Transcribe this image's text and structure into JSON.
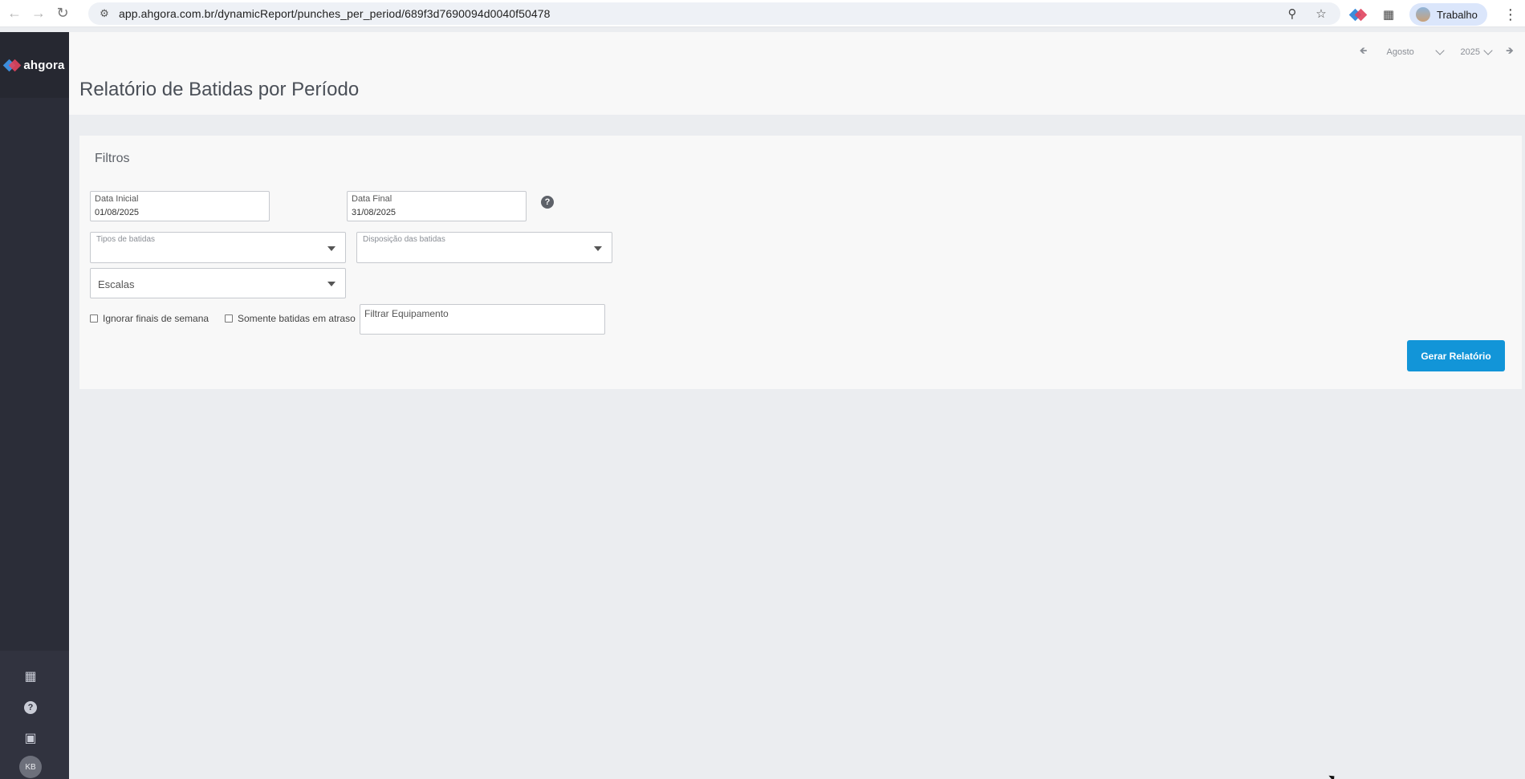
{
  "browser": {
    "url": "app.ahgora.com.br/dynamicReport/punches_per_period/689f3d7690094d0040f50478",
    "profile_name": "Trabalho"
  },
  "sidebar": {
    "brand": "ahgora",
    "avatar_initials": "KB"
  },
  "header": {
    "title": "Relatório de Batidas por Período",
    "month": "Agosto",
    "year": "2025"
  },
  "filters": {
    "title": "Filtros",
    "start_date_label": "Data Inicial",
    "start_date_value": "01/08/2025",
    "end_date_label": "Data Final",
    "end_date_value": "31/08/2025",
    "punch_types_label": "Tipos de batidas",
    "punch_layout_label": "Disposição das batidas",
    "schedules_placeholder": "Escalas",
    "ignore_weekends_label": "Ignorar finais de semana",
    "only_late_label": "Somente batidas em atraso",
    "equipment_placeholder": "Filtrar Equipamento",
    "generate_button": "Gerar Relatório",
    "help_glyph": "?"
  },
  "icons": {
    "back": "arrow-left-icon",
    "forward": "arrow-right-icon",
    "reload": "reload-icon",
    "site_info": "tune-icon",
    "zoom": "zoom-icon",
    "bookmark": "star-icon",
    "extension": "puzzle-icon",
    "apps": "grid-icon",
    "help": "question-icon",
    "company": "building-icon"
  }
}
